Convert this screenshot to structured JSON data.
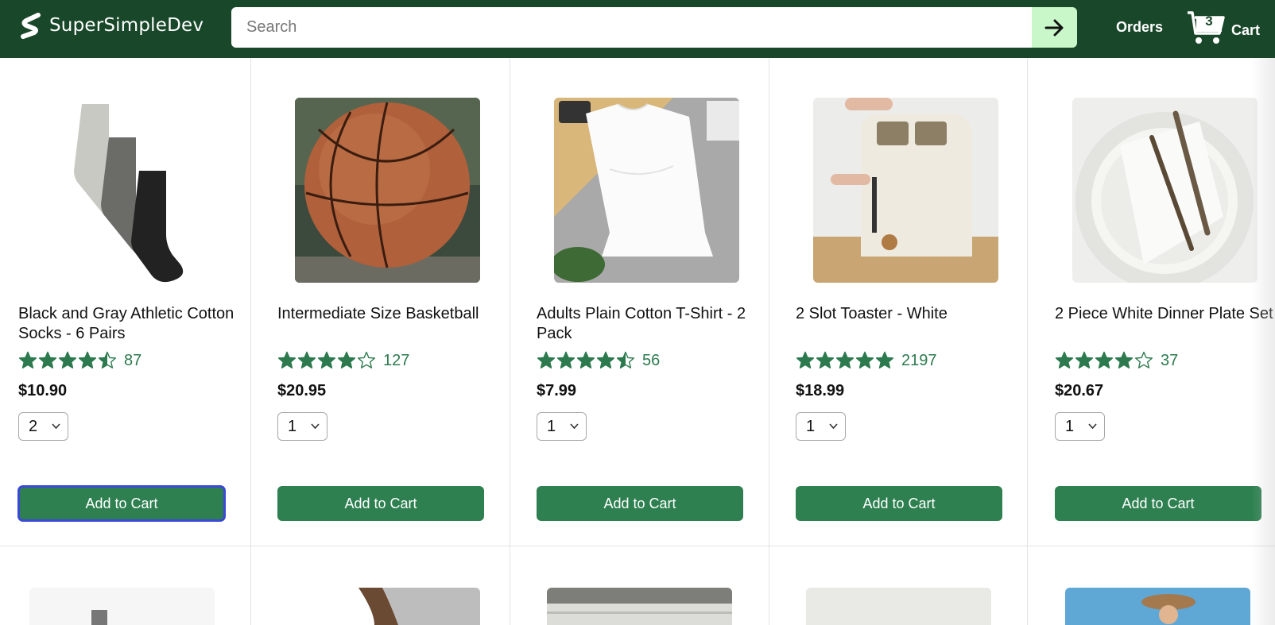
{
  "header": {
    "brand": "SuperSimpleDev",
    "search_placeholder": "Search",
    "orders_label": "Orders",
    "cart_count": "3",
    "cart_label": "Cart"
  },
  "icons": {
    "logo": "supersimpledev-logo",
    "search_button": "arrow-right-icon",
    "cart": "cart-icon",
    "rating": "star-icon",
    "select": "chevron-down-icon"
  },
  "colors": {
    "header_bg": "#19472a",
    "accent": "#2e8050",
    "search_button_bg": "#c9f7c9",
    "rating_text": "#2c7a4e"
  },
  "products": [
    {
      "name": "Black and Gray Athletic Cotton Socks - 6 Pairs",
      "rating_stars": 4.5,
      "rating_count": "87",
      "price": "$10.90",
      "quantity": "2",
      "button": "Add to Cart"
    },
    {
      "name": "Intermediate Size Basketball",
      "rating_stars": 4.0,
      "rating_count": "127",
      "price": "$20.95",
      "quantity": "1",
      "button": "Add to Cart"
    },
    {
      "name": "Adults Plain Cotton T-Shirt - 2 Pack",
      "rating_stars": 4.5,
      "rating_count": "56",
      "price": "$7.99",
      "quantity": "1",
      "button": "Add to Cart"
    },
    {
      "name": "2 Slot Toaster - White",
      "rating_stars": 5.0,
      "rating_count": "2197",
      "price": "$18.99",
      "quantity": "1",
      "button": "Add to Cart"
    },
    {
      "name": "2 Piece White Dinner Plate Set",
      "rating_stars": 4.0,
      "rating_count": "37",
      "price": "$20.67",
      "quantity": "1",
      "button": "Add to Cart"
    }
  ]
}
